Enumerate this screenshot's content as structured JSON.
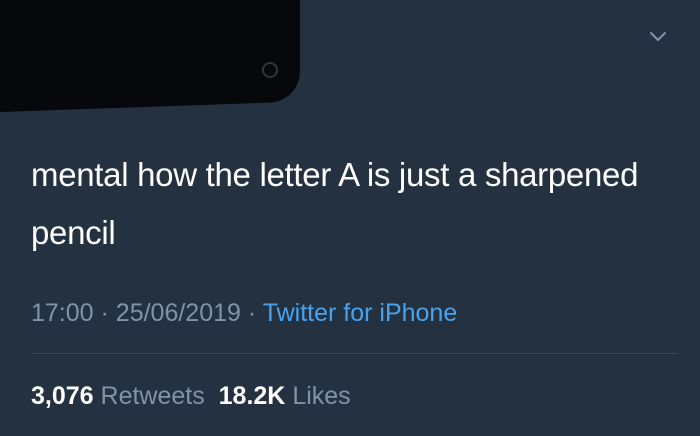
{
  "tweet": {
    "text": "mental how the letter A is just a sharpened pencil",
    "time": "17:00",
    "separator": "·",
    "date": "25/06/2019",
    "source": "Twitter for iPhone"
  },
  "stats": {
    "retweets_count": "3,076",
    "retweets_label": "Retweets",
    "likes_count": "18.2K",
    "likes_label": "Likes"
  },
  "icons": {
    "menu": "chevron-down-icon"
  },
  "colors": {
    "background": "#243140",
    "text": "#ffffff",
    "muted": "#8393a6",
    "link": "#47a3ee",
    "redaction": "#06080b"
  }
}
